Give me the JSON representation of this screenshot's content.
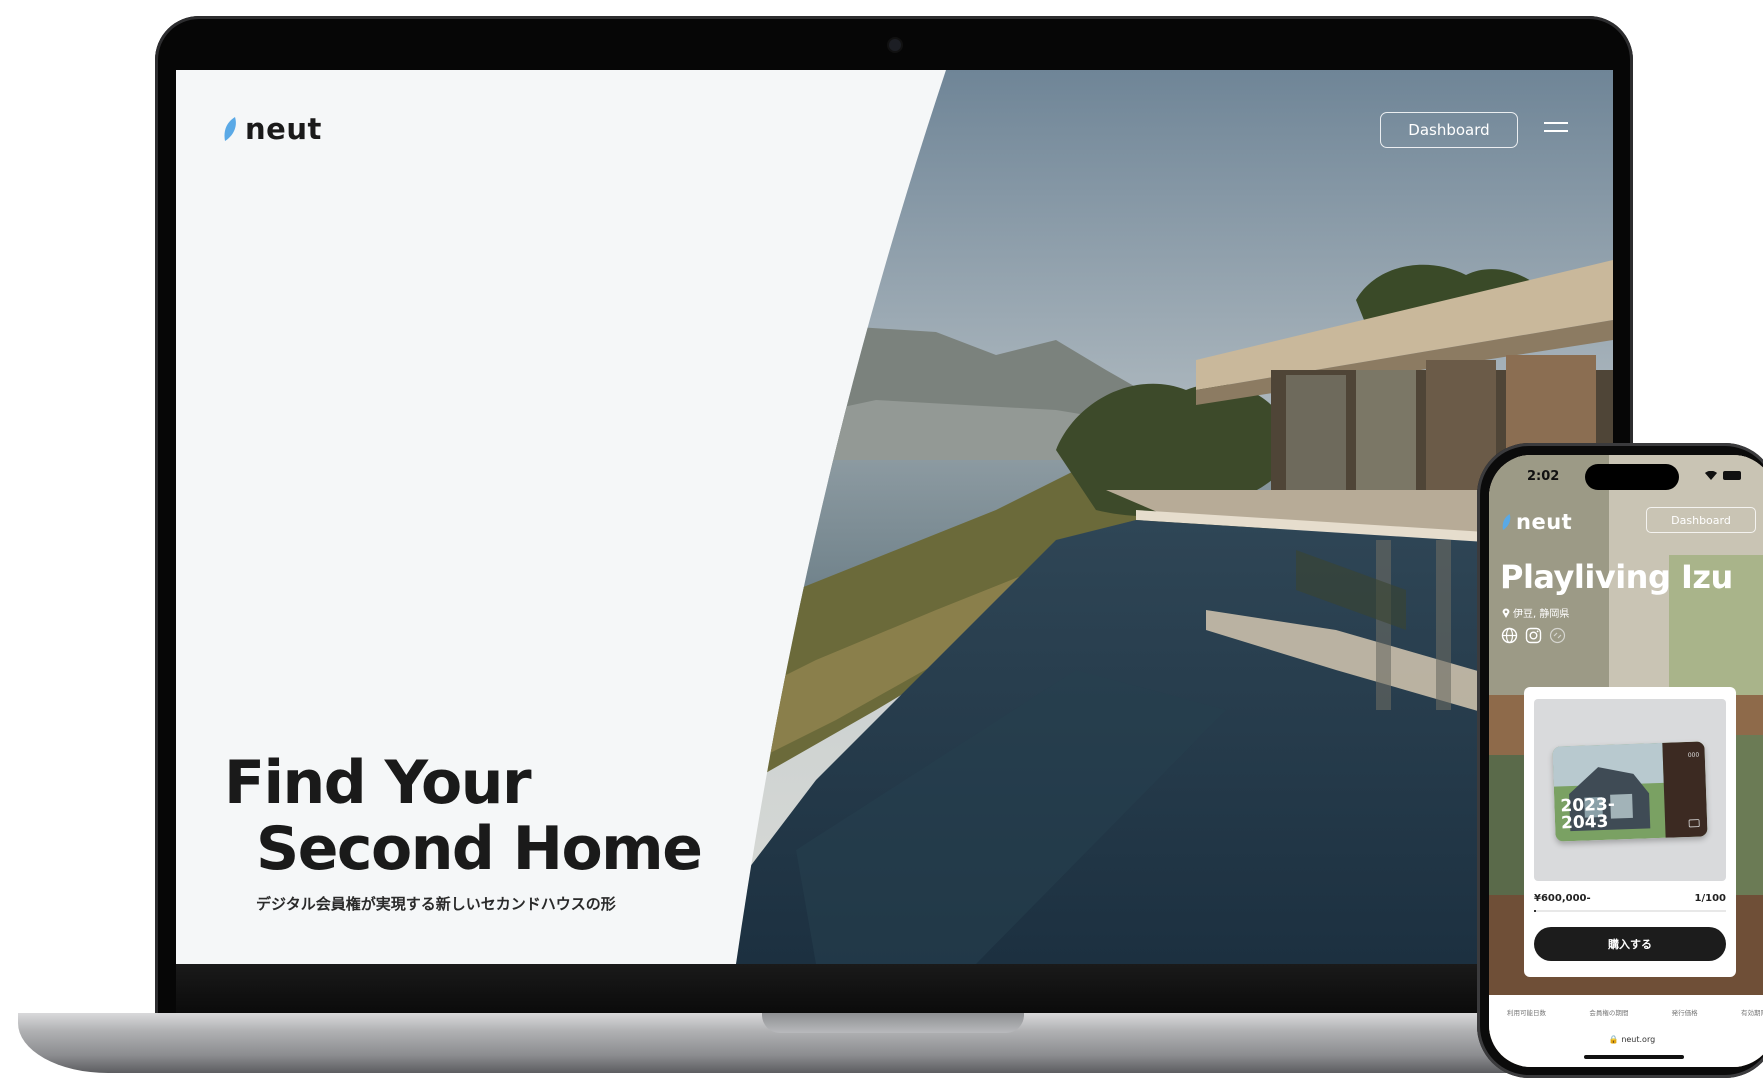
{
  "laptop": {
    "brand": "neut",
    "dashboard_label": "Dashboard",
    "hero": {
      "title_line1": "Find Your",
      "title_line2": "Second Home",
      "subtitle": "デジタル会員権が実現する新しいセカンドハウスの形"
    }
  },
  "phone": {
    "status_time": "2:02",
    "brand": "neut",
    "dashboard_label": "Dashboard",
    "property_title": "Playliving Izu",
    "location": "伊豆, 静岡県",
    "nft_card": {
      "year_start": "2023-",
      "year_end": "2043",
      "number": "000"
    },
    "price": "¥600,000-",
    "supply": "1/100",
    "progress_fraction": 0.01,
    "buy_label": "購入する",
    "stats_labels": [
      "利用可能日数",
      "会員権の期間",
      "発行価格",
      "有効期限"
    ],
    "url": "neut.org",
    "social_icons": [
      "globe-icon",
      "instagram-icon",
      "link-icon"
    ]
  },
  "colors": {
    "brand_leaf": "#5aa9e6",
    "buy_button": "#1c1c1c"
  }
}
